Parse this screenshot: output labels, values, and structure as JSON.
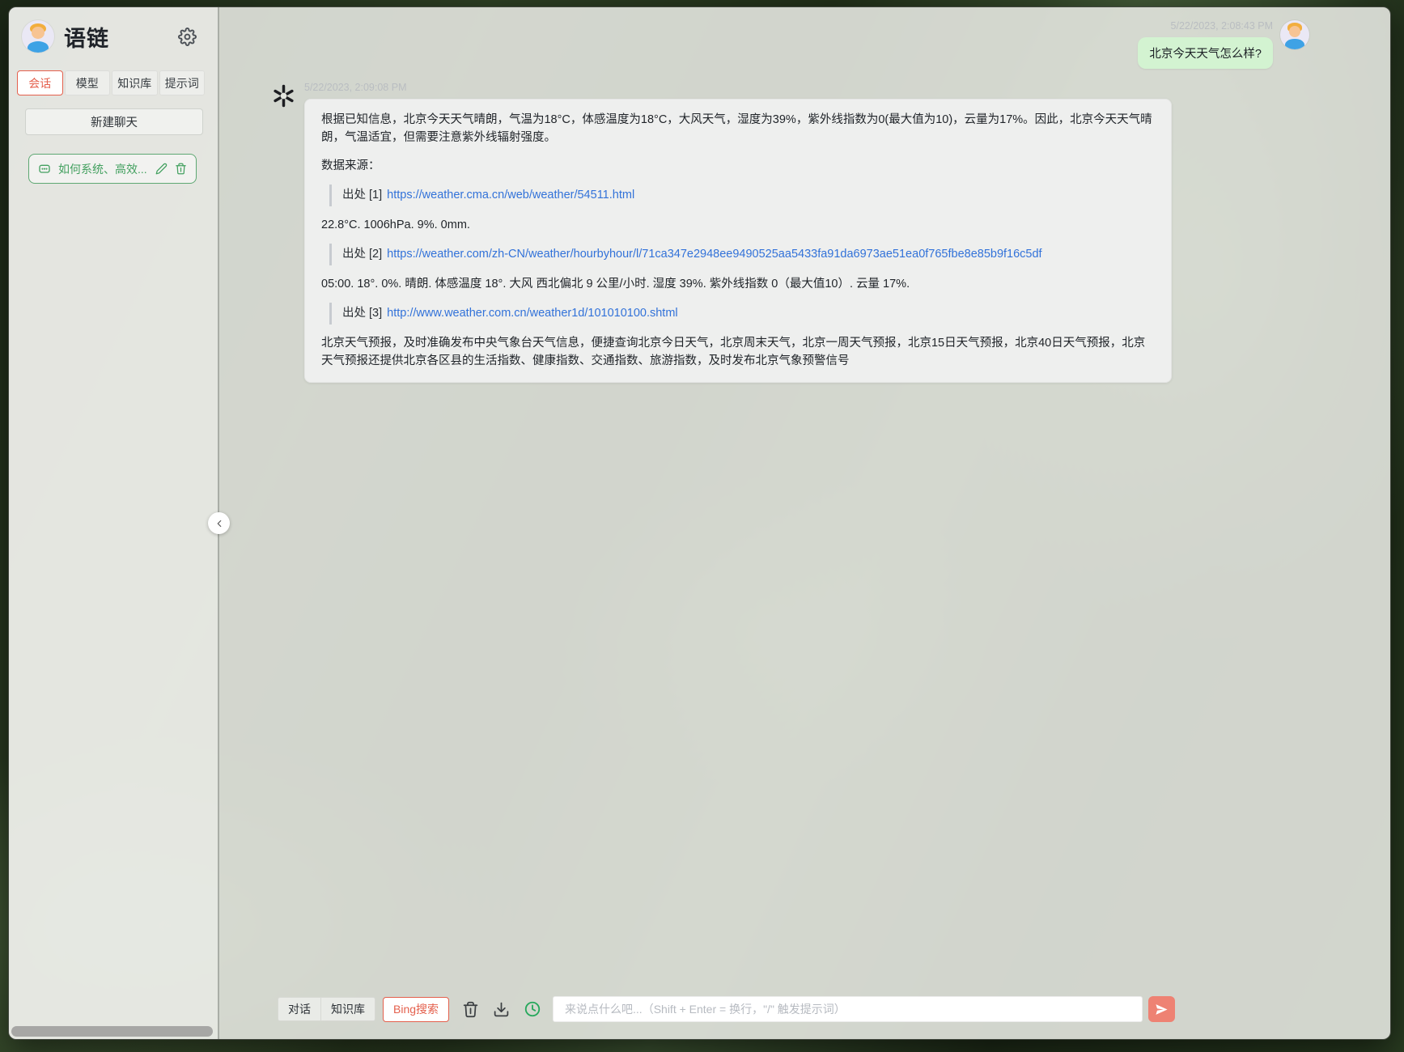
{
  "app": {
    "title": "语链"
  },
  "sidebar": {
    "tabs": [
      {
        "label": "会话"
      },
      {
        "label": "模型"
      },
      {
        "label": "知识库"
      },
      {
        "label": "提示词"
      }
    ],
    "new_chat_label": "新建聊天",
    "conversation": {
      "title": "如何系统、高效..."
    }
  },
  "chat": {
    "user_message": {
      "timestamp": "5/22/2023, 2:08:43 PM",
      "text": "北京今天天气怎么样?"
    },
    "assistant_message": {
      "timestamp": "5/22/2023, 2:09:08 PM",
      "paragraph1": "根据已知信息，北京今天天气晴朗，气温为18°C，体感温度为18°C，大风天气，湿度为39%，紫外线指数为0(最大值为10)，云量为17%。因此，北京今天天气晴朗，气温适宜，但需要注意紫外线辐射强度。",
      "sources_label": "数据来源：",
      "citations": [
        {
          "prefix": "出处 [1]",
          "url": "https://weather.cma.cn/web/weather/54511.html",
          "note": "22.8°C. 1006hPa. 9%. 0mm."
        },
        {
          "prefix": "出处 [2]",
          "url": "https://weather.com/zh-CN/weather/hourbyhour/l/71ca347e2948ee9490525aa5433fa91da6973ae51ea0f765fbe8e85b9f16c5df",
          "note": "05:00. 18°. 0%. 晴朗. 体感温度 18°. 大风 西北偏北 9 公里/小时. 湿度 39%. 紫外线指数 0（最大值10）. 云量 17%."
        },
        {
          "prefix": "出处 [3]",
          "url": "http://www.weather.com.cn/weather1d/101010100.shtml",
          "note": "北京天气预报，及时准确发布中央气象台天气信息，便捷查询北京今日天气，北京周末天气，北京一周天气预报，北京15日天气预报，北京40日天气预报，北京天气预报还提供北京各区县的生活指数、健康指数、交通指数、旅游指数，及时发布北京气象预警信号"
        }
      ]
    }
  },
  "toolbar": {
    "buttons": [
      {
        "label": "对话"
      },
      {
        "label": "知识库"
      },
      {
        "label": "Bing搜索"
      }
    ],
    "input_placeholder": "来说点什么吧...（Shift + Enter = 换行，\"/\" 触发提示词）"
  },
  "colors": {
    "accent_red": "#e4604d",
    "accent_green": "#43a05f",
    "link_blue": "#3272d9",
    "user_bubble": "#d3f3d1",
    "send_bg": "#ee8273"
  }
}
